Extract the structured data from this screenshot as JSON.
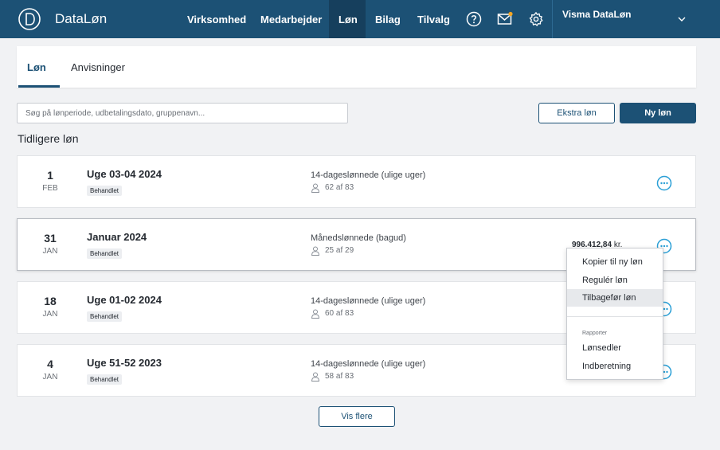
{
  "app": {
    "brand": "DataLøn"
  },
  "nav": {
    "items": [
      "Virksomhed",
      "Medarbejder",
      "Løn",
      "Bilag",
      "Tilvalg"
    ],
    "active": "Løn",
    "icons": [
      "help-icon",
      "mail-icon",
      "gear-icon"
    ],
    "account": "Visma DataLøn"
  },
  "tabs": {
    "items": [
      "Løn",
      "Anvisninger"
    ],
    "active": "Løn"
  },
  "search": {
    "placeholder": "Søg på lønperiode, udbetalingsdato, gruppenavn..."
  },
  "actions": {
    "extra": "Ekstra løn",
    "new": "Ny løn"
  },
  "section": {
    "title": "Tidligere løn"
  },
  "payrolls": [
    {
      "day": "1",
      "month": "FEB",
      "period": "Uge 03-04 2024",
      "status": "Behandlet",
      "group": "14-dageslønnede (ulige uger)",
      "count": "62 af 83",
      "amount": "",
      "currency": ""
    },
    {
      "day": "31",
      "month": "JAN",
      "period": "Januar 2024",
      "status": "Behandlet",
      "group": "Månedslønnede (bagud)",
      "count": "25 af 29",
      "amount": "996.412,84",
      "currency": "kr."
    },
    {
      "day": "18",
      "month": "JAN",
      "period": "Uge 01-02 2024",
      "status": "Behandlet",
      "group": "14-dageslønnede (ulige uger)",
      "count": "60 af 83",
      "amount": "",
      "currency": ""
    },
    {
      "day": "4",
      "month": "JAN",
      "period": "Uge 51-52 2023",
      "status": "Behandlet",
      "group": "14-dageslønnede (ulige uger)",
      "count": "58 af 83",
      "amount": "",
      "currency": ""
    }
  ],
  "context_menu": {
    "items": [
      "Kopier til ny løn",
      "Regulér løn",
      "Tilbagefør løn"
    ],
    "hovered": "Tilbagefør løn",
    "section_label": "Rapporter",
    "report_items": [
      "Lønsedler",
      "Indberetning"
    ]
  },
  "load_more": "Vis flere",
  "colors": {
    "primary": "#1c5175",
    "accent": "#2a9fd6",
    "notification": "#f5a623"
  }
}
